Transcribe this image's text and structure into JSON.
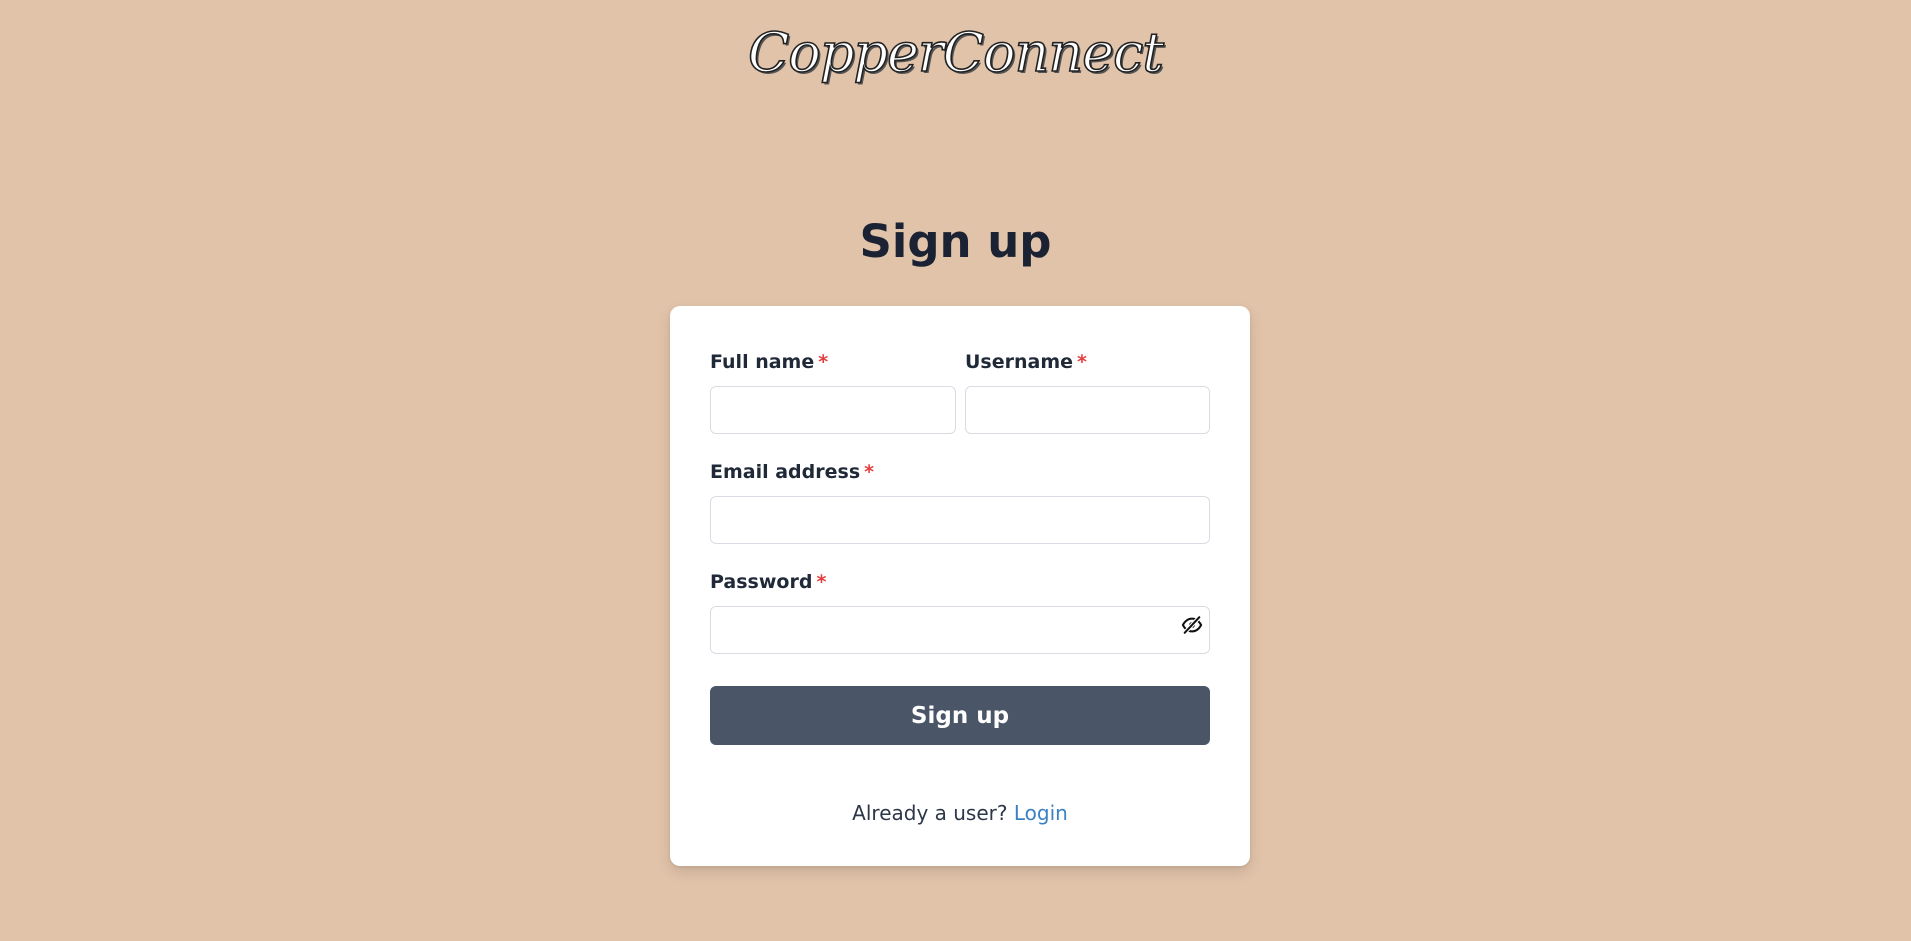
{
  "brand": {
    "logo_text": "CopperConnect"
  },
  "page": {
    "title": "Sign up"
  },
  "form": {
    "required_marker": "*",
    "full_name": {
      "label": "Full name",
      "value": "",
      "placeholder": ""
    },
    "username": {
      "label": "Username",
      "value": "",
      "placeholder": ""
    },
    "email": {
      "label": "Email address",
      "value": "",
      "placeholder": ""
    },
    "password": {
      "label": "Password",
      "value": "",
      "placeholder": "",
      "toggle_icon": "eye-off-icon"
    },
    "submit_label": "Sign up"
  },
  "footer": {
    "prompt": "Already a user?",
    "login_label": "Login"
  },
  "colors": {
    "background": "#e1c3a9",
    "button": "#4a5568",
    "required": "#e53e3e",
    "link": "#3b82c4"
  }
}
